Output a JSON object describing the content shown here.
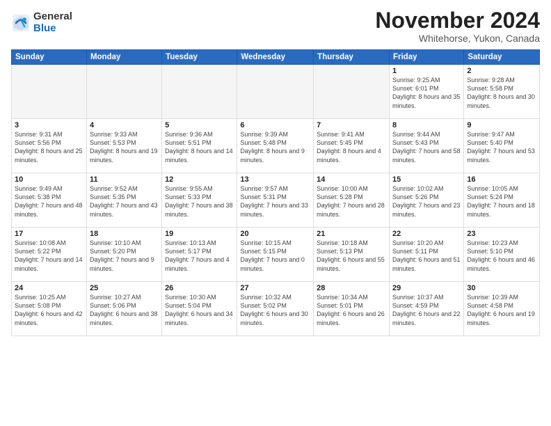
{
  "header": {
    "logo_general": "General",
    "logo_blue": "Blue",
    "title": "November 2024",
    "location": "Whitehorse, Yukon, Canada"
  },
  "weekdays": [
    "Sunday",
    "Monday",
    "Tuesday",
    "Wednesday",
    "Thursday",
    "Friday",
    "Saturday"
  ],
  "weeks": [
    [
      {
        "day": "",
        "info": ""
      },
      {
        "day": "",
        "info": ""
      },
      {
        "day": "",
        "info": ""
      },
      {
        "day": "",
        "info": ""
      },
      {
        "day": "",
        "info": ""
      },
      {
        "day": "1",
        "info": "Sunrise: 9:25 AM\nSunset: 6:01 PM\nDaylight: 8 hours\nand 35 minutes."
      },
      {
        "day": "2",
        "info": "Sunrise: 9:28 AM\nSunset: 5:58 PM\nDaylight: 8 hours\nand 30 minutes."
      }
    ],
    [
      {
        "day": "3",
        "info": "Sunrise: 9:31 AM\nSunset: 5:56 PM\nDaylight: 8 hours\nand 25 minutes."
      },
      {
        "day": "4",
        "info": "Sunrise: 9:33 AM\nSunset: 5:53 PM\nDaylight: 8 hours\nand 19 minutes."
      },
      {
        "day": "5",
        "info": "Sunrise: 9:36 AM\nSunset: 5:51 PM\nDaylight: 8 hours\nand 14 minutes."
      },
      {
        "day": "6",
        "info": "Sunrise: 9:39 AM\nSunset: 5:48 PM\nDaylight: 8 hours\nand 9 minutes."
      },
      {
        "day": "7",
        "info": "Sunrise: 9:41 AM\nSunset: 5:45 PM\nDaylight: 8 hours\nand 4 minutes."
      },
      {
        "day": "8",
        "info": "Sunrise: 9:44 AM\nSunset: 5:43 PM\nDaylight: 7 hours\nand 58 minutes."
      },
      {
        "day": "9",
        "info": "Sunrise: 9:47 AM\nSunset: 5:40 PM\nDaylight: 7 hours\nand 53 minutes."
      }
    ],
    [
      {
        "day": "10",
        "info": "Sunrise: 9:49 AM\nSunset: 5:38 PM\nDaylight: 7 hours\nand 48 minutes."
      },
      {
        "day": "11",
        "info": "Sunrise: 9:52 AM\nSunset: 5:35 PM\nDaylight: 7 hours\nand 43 minutes."
      },
      {
        "day": "12",
        "info": "Sunrise: 9:55 AM\nSunset: 5:33 PM\nDaylight: 7 hours\nand 38 minutes."
      },
      {
        "day": "13",
        "info": "Sunrise: 9:57 AM\nSunset: 5:31 PM\nDaylight: 7 hours\nand 33 minutes."
      },
      {
        "day": "14",
        "info": "Sunrise: 10:00 AM\nSunset: 5:28 PM\nDaylight: 7 hours\nand 28 minutes."
      },
      {
        "day": "15",
        "info": "Sunrise: 10:02 AM\nSunset: 5:26 PM\nDaylight: 7 hours\nand 23 minutes."
      },
      {
        "day": "16",
        "info": "Sunrise: 10:05 AM\nSunset: 5:24 PM\nDaylight: 7 hours\nand 18 minutes."
      }
    ],
    [
      {
        "day": "17",
        "info": "Sunrise: 10:08 AM\nSunset: 5:22 PM\nDaylight: 7 hours\nand 14 minutes."
      },
      {
        "day": "18",
        "info": "Sunrise: 10:10 AM\nSunset: 5:20 PM\nDaylight: 7 hours\nand 9 minutes."
      },
      {
        "day": "19",
        "info": "Sunrise: 10:13 AM\nSunset: 5:17 PM\nDaylight: 7 hours\nand 4 minutes."
      },
      {
        "day": "20",
        "info": "Sunrise: 10:15 AM\nSunset: 5:15 PM\nDaylight: 7 hours\nand 0 minutes."
      },
      {
        "day": "21",
        "info": "Sunrise: 10:18 AM\nSunset: 5:13 PM\nDaylight: 6 hours\nand 55 minutes."
      },
      {
        "day": "22",
        "info": "Sunrise: 10:20 AM\nSunset: 5:11 PM\nDaylight: 6 hours\nand 51 minutes."
      },
      {
        "day": "23",
        "info": "Sunrise: 10:23 AM\nSunset: 5:10 PM\nDaylight: 6 hours\nand 46 minutes."
      }
    ],
    [
      {
        "day": "24",
        "info": "Sunrise: 10:25 AM\nSunset: 5:08 PM\nDaylight: 6 hours\nand 42 minutes."
      },
      {
        "day": "25",
        "info": "Sunrise: 10:27 AM\nSunset: 5:06 PM\nDaylight: 6 hours\nand 38 minutes."
      },
      {
        "day": "26",
        "info": "Sunrise: 10:30 AM\nSunset: 5:04 PM\nDaylight: 6 hours\nand 34 minutes."
      },
      {
        "day": "27",
        "info": "Sunrise: 10:32 AM\nSunset: 5:02 PM\nDaylight: 6 hours\nand 30 minutes."
      },
      {
        "day": "28",
        "info": "Sunrise: 10:34 AM\nSunset: 5:01 PM\nDaylight: 6 hours\nand 26 minutes."
      },
      {
        "day": "29",
        "info": "Sunrise: 10:37 AM\nSunset: 4:59 PM\nDaylight: 6 hours\nand 22 minutes."
      },
      {
        "day": "30",
        "info": "Sunrise: 10:39 AM\nSunset: 4:58 PM\nDaylight: 6 hours\nand 19 minutes."
      }
    ]
  ]
}
